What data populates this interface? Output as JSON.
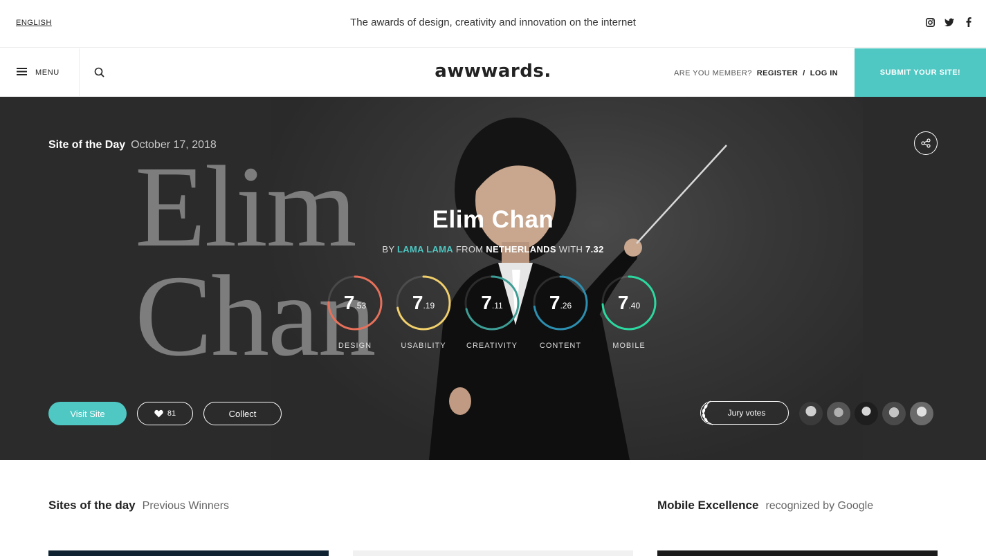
{
  "topbar": {
    "language": "ENGLISH",
    "tagline": "The awards of design, creativity and innovation on the internet",
    "social": [
      "instagram-icon",
      "twitter-icon",
      "facebook-icon"
    ]
  },
  "navbar": {
    "menu_label": "MENU",
    "logo": "awwwards.",
    "member_question": "ARE YOU MEMBER?",
    "register": "REGISTER",
    "separator": "/",
    "login": "LOG IN",
    "submit": "SUBMIT YOUR SITE!"
  },
  "hero": {
    "award": "Site of the Day",
    "date": "October 17, 2018",
    "background_text": [
      "Elim",
      "Chan"
    ],
    "title": "Elim Chan",
    "by_prefix": "BY",
    "author": "LAMA LAMA",
    "from_prefix": "FROM",
    "country": "NETHERLANDS",
    "with_prefix": "WITH",
    "overall_score": "7.32",
    "scores": [
      {
        "int": "7",
        "dec": ".53",
        "label": "DESIGN",
        "value": 7.53,
        "color": "#e8705a"
      },
      {
        "int": "7",
        "dec": ".19",
        "label": "USABILITY",
        "value": 7.19,
        "color": "#f1cf6b"
      },
      {
        "int": "7",
        "dec": ".11",
        "label": "CREATIVITY",
        "value": 7.11,
        "color": "#3d9e96"
      },
      {
        "int": "7",
        "dec": ".26",
        "label": "CONTENT",
        "value": 7.26,
        "color": "#2c8fb0"
      },
      {
        "int": "7",
        "dec": ".40",
        "label": "MOBILE",
        "value": 7.4,
        "color": "#2bd9a0"
      }
    ],
    "visit_label": "Visit Site",
    "likes": "81",
    "collect_label": "Collect",
    "jury_label": "Jury votes"
  },
  "sections": {
    "left_title": "Sites of the day",
    "left_link": "Previous Winners",
    "right_title": "Mobile Excellence",
    "right_sub": "recognized by Google"
  },
  "colors": {
    "accent": "#4fc7c2"
  }
}
